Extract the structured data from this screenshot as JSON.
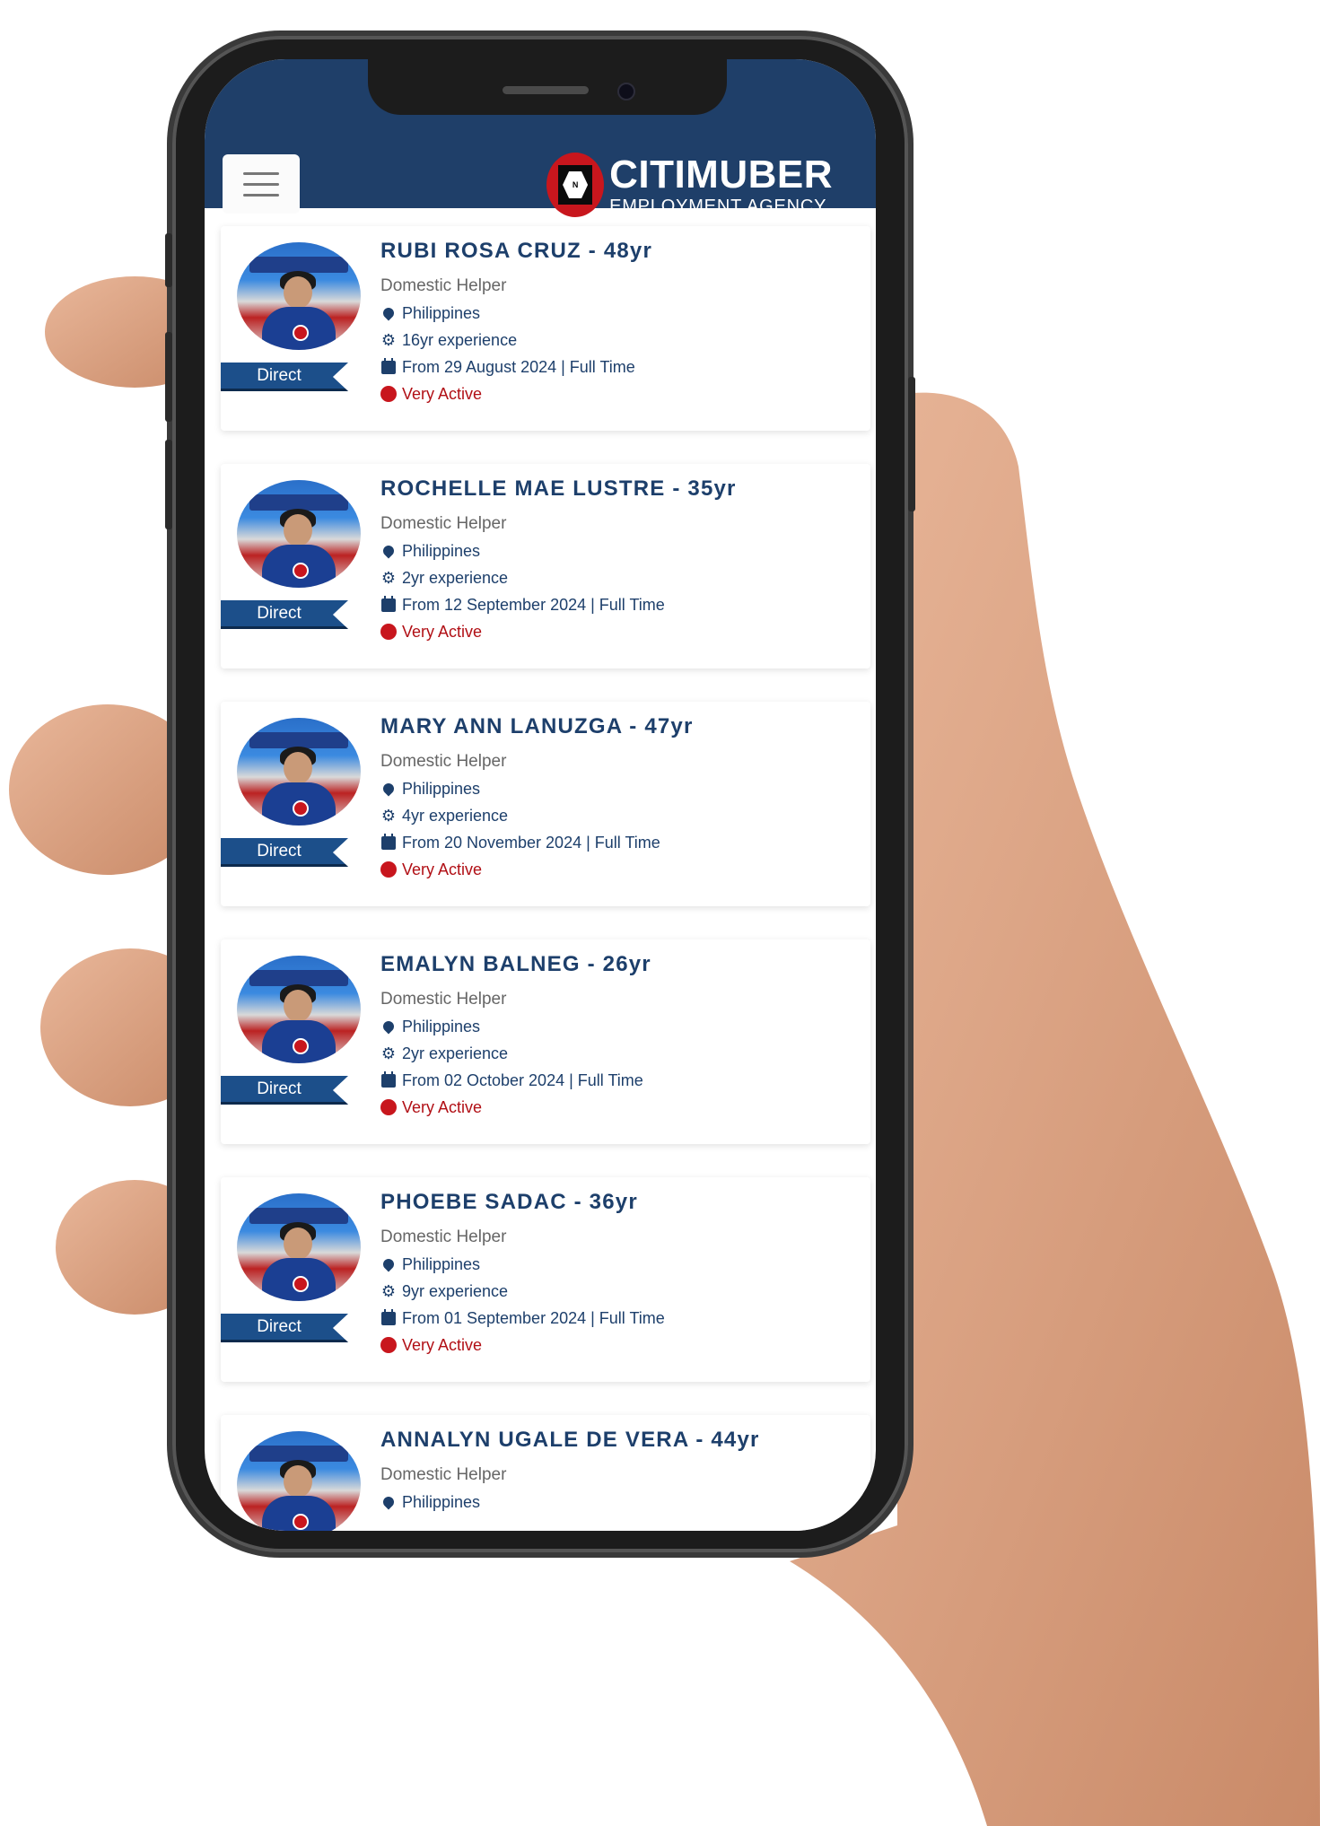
{
  "header": {
    "menu_icon": "hamburger-menu-icon",
    "logo": {
      "mark_letter": "N",
      "title": "CITIMUBER",
      "subtitle": "EMPLOYMENT AGENCY"
    }
  },
  "candidates": [
    {
      "name": "RUBI ROSA CRUZ - 48yr",
      "role": "Domestic Helper",
      "badge": "Direct",
      "country": "Philippines",
      "experience": "16yr experience",
      "availability": "From 29 August 2024 | Full Time",
      "status": "Very Active"
    },
    {
      "name": "ROCHELLE MAE LUSTRE - 35yr",
      "role": "Domestic Helper",
      "badge": "Direct",
      "country": "Philippines",
      "experience": "2yr experience",
      "availability": "From 12 September 2024 | Full Time",
      "status": "Very Active"
    },
    {
      "name": "MARY ANN LANUZGA - 47yr",
      "role": "Domestic Helper",
      "badge": "Direct",
      "country": "Philippines",
      "experience": "4yr experience",
      "availability": "From 20 November 2024 | Full Time",
      "status": "Very Active"
    },
    {
      "name": "EMALYN BALNEG - 26yr",
      "role": "Domestic Helper",
      "badge": "Direct",
      "country": "Philippines",
      "experience": "2yr experience",
      "availability": "From 02 October 2024 | Full Time",
      "status": "Very Active"
    },
    {
      "name": "PHOEBE SADAC - 36yr",
      "role": "Domestic Helper",
      "badge": "Direct",
      "country": "Philippines",
      "experience": "9yr experience",
      "availability": "From 01 September 2024 | Full Time",
      "status": "Very Active"
    },
    {
      "name": "ANNALYN UGALE DE VERA - 44yr",
      "role": "Domestic Helper",
      "country": "Philippines"
    }
  ],
  "colors": {
    "header_bg": "#1f3f69",
    "brand_red": "#c8161d",
    "text_navy": "#1d3f6b",
    "status_red": "#b10f15",
    "ribbon_blue": "#1c4f8a"
  }
}
